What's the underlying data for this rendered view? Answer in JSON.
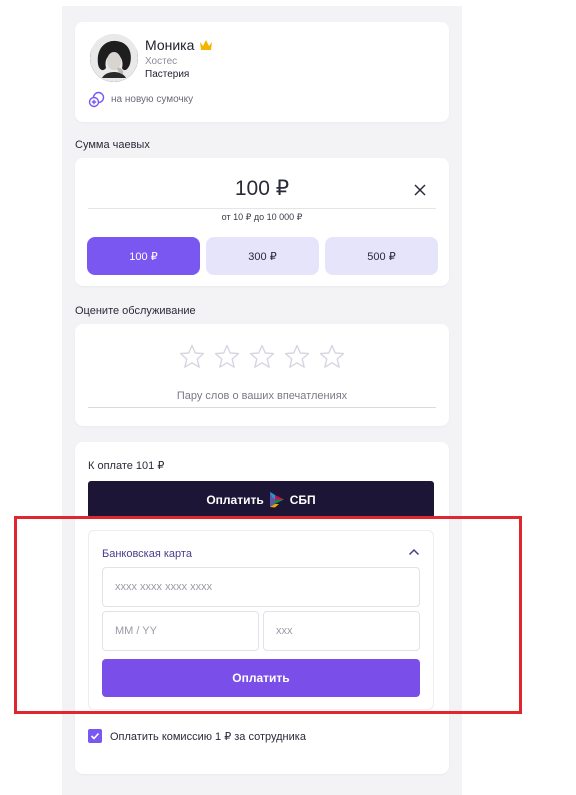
{
  "profile": {
    "name": "Моника",
    "role": "Хостес",
    "place": "Пастерия",
    "goal": "на новую сумочку"
  },
  "tip": {
    "section_label": "Сумма чаевых",
    "amount": "100 ₽",
    "range": "от 10 ₽ до 10 000 ₽",
    "presets": [
      "100 ₽",
      "300 ₽",
      "500 ₽"
    ],
    "active_preset": "100 ₽"
  },
  "rating": {
    "section_label": "Оцените обслуживание",
    "feedback_placeholder": "Пару слов о ваших впечатлениях",
    "stars_total": 5,
    "stars_selected": 0
  },
  "payment": {
    "total": "К оплате 101 ₽",
    "sbp_button": "Оплатить",
    "sbp_label": "СБП",
    "bank_card": {
      "title": "Банковская карта",
      "card_number_placeholder": "xxxx xxxx xxxx xxxx",
      "expiry_placeholder": "MM / YY",
      "cvc_placeholder": "xxx",
      "pay_button": "Оплатить"
    },
    "fee": {
      "label": "Оплатить комиссию 1 ₽ за сотрудника",
      "checked": true
    }
  },
  "colors": {
    "accent": "#7b57f2",
    "preset_bg": "#e5e4fa",
    "sbp_bg": "#1d1536",
    "highlight": "#e0262e"
  },
  "icons": [
    "crown-icon",
    "goal-icon",
    "close-icon",
    "star-icon",
    "sbp-logo-icon",
    "chevron-up-icon",
    "check-icon"
  ]
}
